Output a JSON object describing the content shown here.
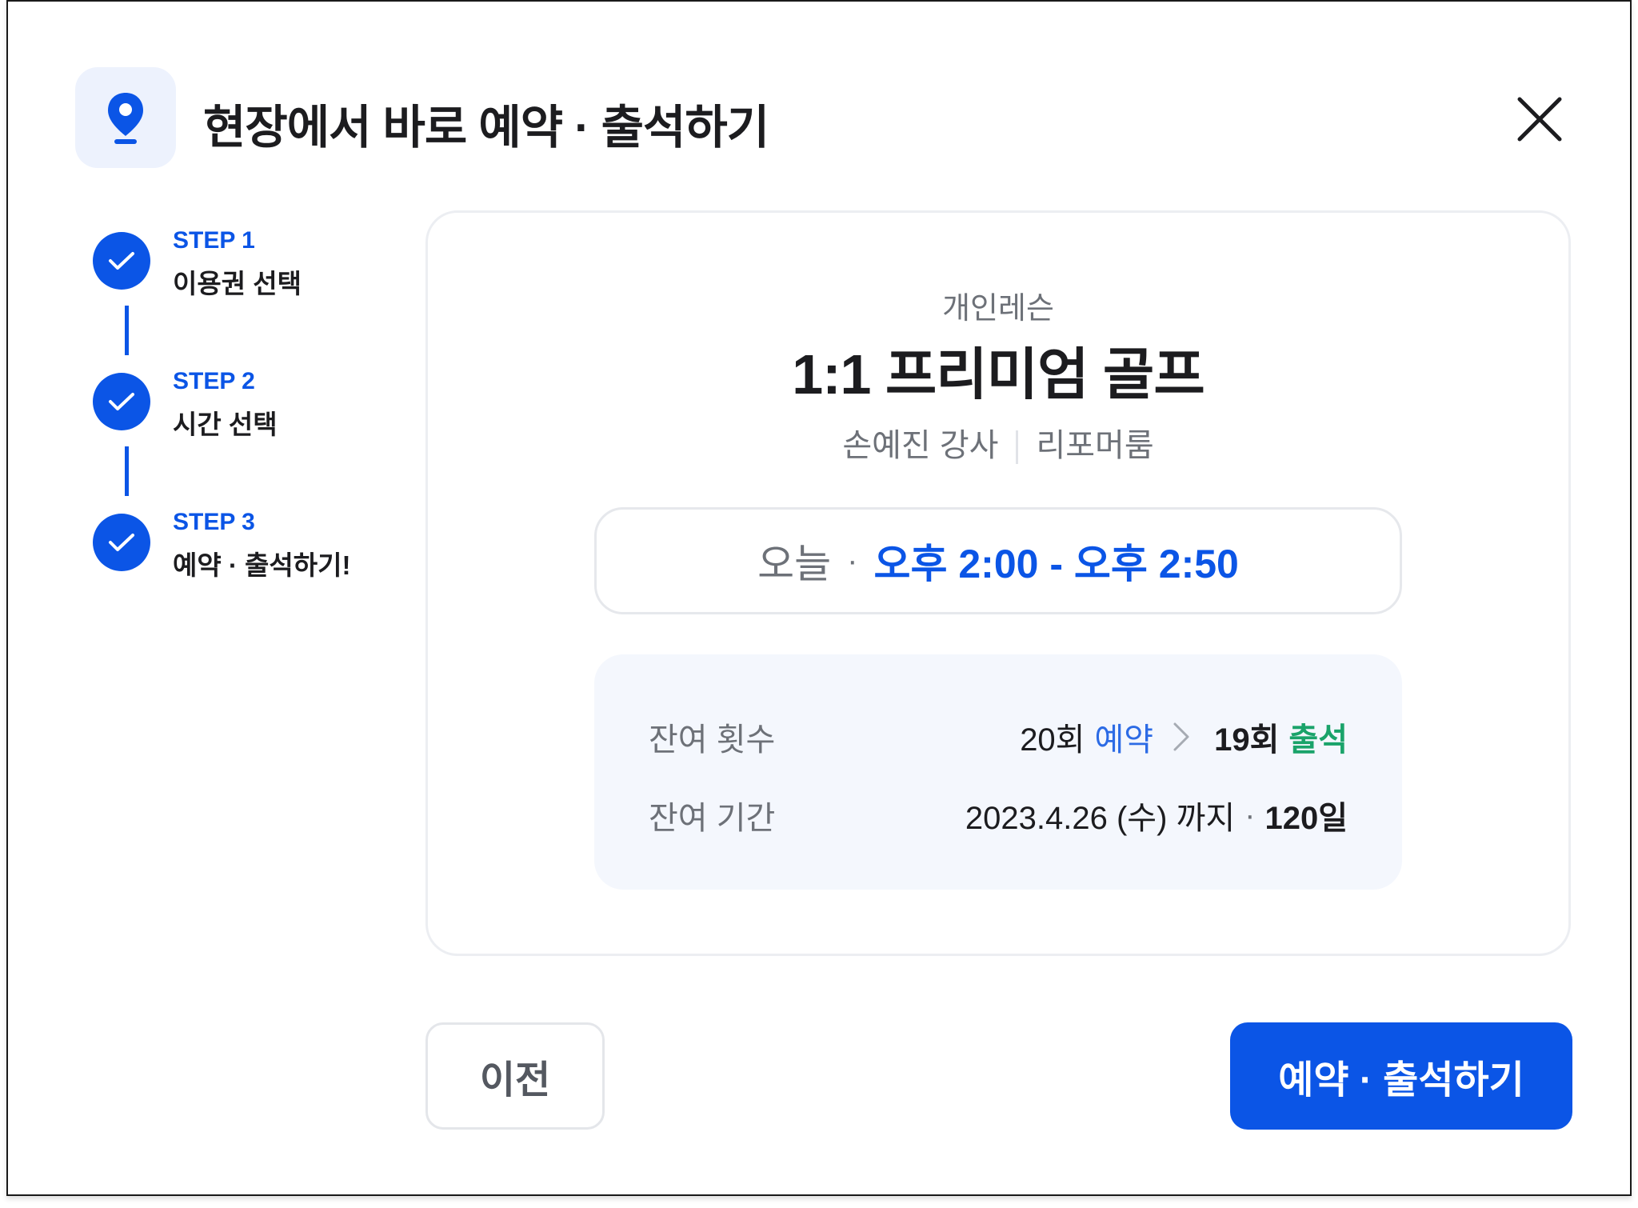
{
  "header": {
    "title": "현장에서 바로 예약 · 출석하기",
    "icon": "location-pin-icon",
    "close_icon": "close-icon"
  },
  "steps": [
    {
      "label": "STEP 1",
      "title": "이용권 선택",
      "status": "completed"
    },
    {
      "label": "STEP 2",
      "title": "시간 선택",
      "status": "completed"
    },
    {
      "label": "STEP 3",
      "title": "예약 · 출석하기!",
      "status": "completed"
    }
  ],
  "lesson": {
    "category": "개인레슨",
    "name": "1:1 프리미엄 골프",
    "instructor": "손예진 강사",
    "room": "리포머룸"
  },
  "time": {
    "day": "오늘",
    "separator": "·",
    "range": "오후 2:00 - 오후 2:50"
  },
  "info": {
    "remaining_count_label": "잔여 횟수",
    "count_before": "20회",
    "count_before_tag": "예약",
    "count_after": "19회",
    "count_after_tag": "출석",
    "remaining_period_label": "잔여 기간",
    "period_until": "2023.4.26 (수) 까지",
    "period_dot": "·",
    "period_days": "120일"
  },
  "buttons": {
    "prev": "이전",
    "submit": "예약 · 출석하기"
  },
  "colors": {
    "primary": "#0b55e6",
    "accent_green": "#1aa36a",
    "muted_text": "#6d7178",
    "info_bg": "#f4f7fd"
  }
}
